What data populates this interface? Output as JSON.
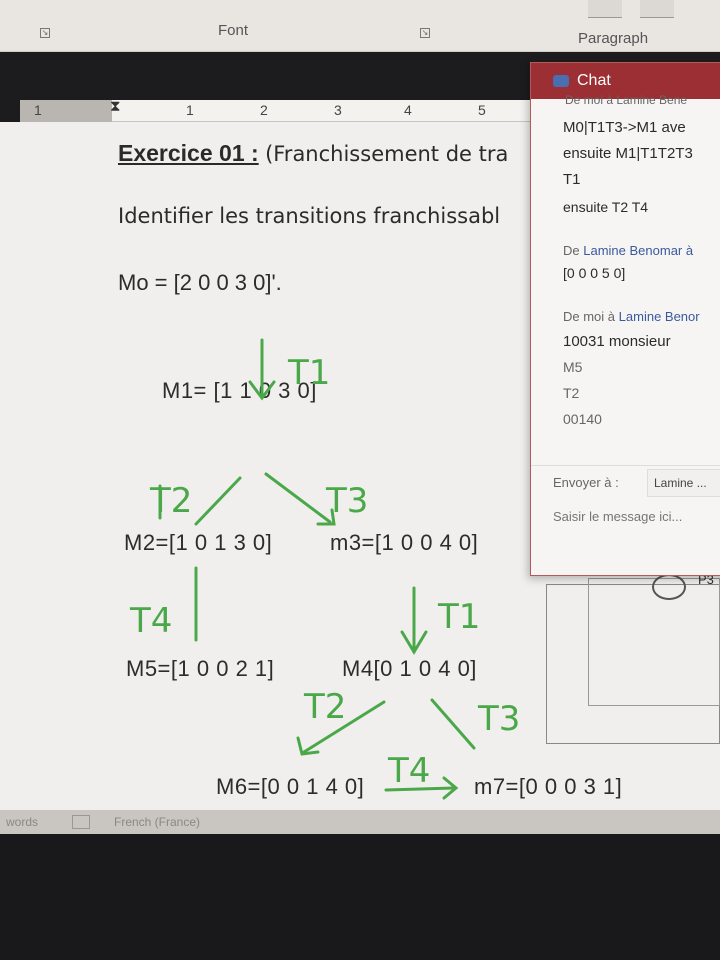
{
  "ribbon": {
    "groups": [
      "Font",
      "Paragraph"
    ]
  },
  "ruler": {
    "numbers": [
      "1",
      "1",
      "2",
      "3",
      "4",
      "5"
    ]
  },
  "document": {
    "title_bold": "Exercice 01 :",
    "title_rest": "(Franchissement de tra",
    "instruction": "Identifier les transitions franchissabl",
    "m0": "Mo = [2  0  0  3  0]'.",
    "markings": {
      "m1": "M1= [1 1 0 3 0]",
      "m2": "M2=[1 0 1 3 0]",
      "m3": "m3=[1 0 0 4 0]",
      "m5": "M5=[1 0 0 2 1]",
      "m4": "M4[0 1  0 4 0]",
      "m6": "M6=[0 0 1 4 0]",
      "m7": "m7=[0 0 0 3 1]"
    }
  },
  "handwriting": {
    "labels": [
      "T1",
      "T2",
      "T3",
      "T4",
      "T1",
      "T2",
      "T3",
      "T4"
    ],
    "color": "#4aa84a"
  },
  "chat": {
    "title": "Chat",
    "cut_line": "De moi à Lamine Bene",
    "messages": [
      "M0|T1T3->M1 ave",
      "ensuite M1|T1T2T3",
      "T1",
      "ensuite T2 T4"
    ],
    "msg2_meta_prefix": "De",
    "msg2_meta_who": "Lamine Benomar à",
    "msg2_lines": [
      "[0 0 0 5 0]"
    ],
    "msg3_meta_prefix": "De moi à",
    "msg3_meta_who": "Lamine Benor",
    "msg3_lines": [
      "10031 monsieur",
      "M5",
      "T2",
      "00140"
    ],
    "send_to_label": "Envoyer à :",
    "send_to_value": "Lamine ...",
    "input_placeholder": "Saisir le message ici..."
  },
  "side": {
    "p3_label": "P3"
  },
  "statusbar": {
    "words": "words",
    "language": "French (France)"
  },
  "colors": {
    "chat_header": "#9c2f34",
    "handwriting": "#4aa84a"
  }
}
